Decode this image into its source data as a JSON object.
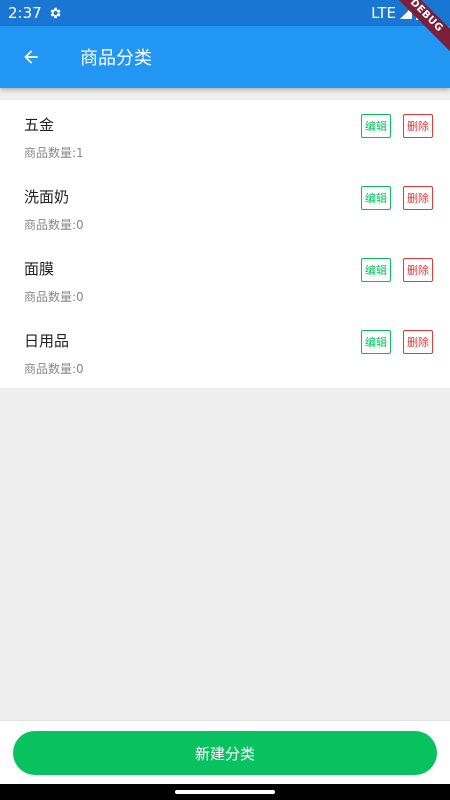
{
  "status_bar": {
    "time": "2:37",
    "network": "LTE"
  },
  "app_bar": {
    "title": "商品分类"
  },
  "debug_banner": "DEBUG",
  "categories": [
    {
      "name": "五金",
      "count_text": "商品数量:1"
    },
    {
      "name": "洗面奶",
      "count_text": "商品数量:0"
    },
    {
      "name": "面膜",
      "count_text": "商品数量:0"
    },
    {
      "name": "日用品",
      "count_text": "商品数量:0"
    }
  ],
  "actions": {
    "edit_label": "编辑",
    "delete_label": "删除"
  },
  "footer": {
    "new_category_label": "新建分类"
  },
  "colors": {
    "primary": "#2196f3",
    "status_bar": "#1976d2",
    "green": "#08c25f",
    "red": "#e53935"
  }
}
